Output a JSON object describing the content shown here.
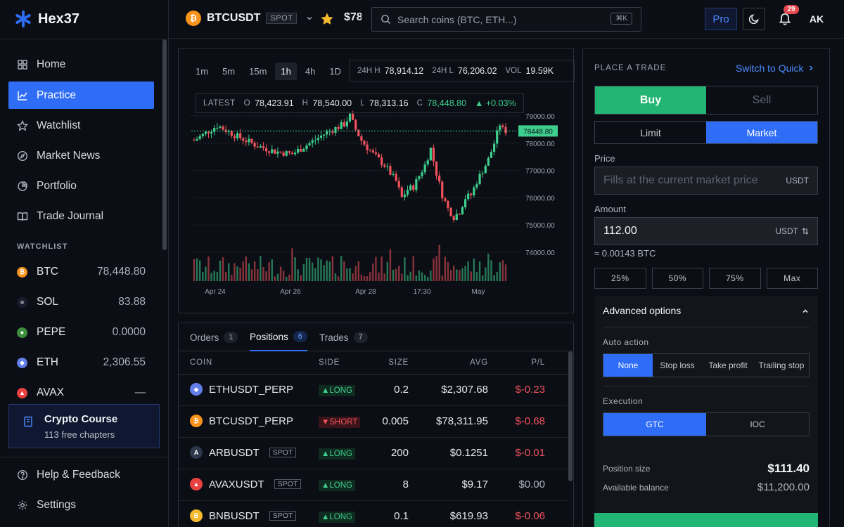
{
  "app": {
    "name": "Hex37"
  },
  "sidebar": {
    "nav": [
      {
        "label": "Home",
        "icon": "home-icon"
      },
      {
        "label": "Practice",
        "icon": "chart-line-icon",
        "active": true
      },
      {
        "label": "Watchlist",
        "icon": "star-icon"
      },
      {
        "label": "Market News",
        "icon": "compass-icon"
      },
      {
        "label": "Portfolio",
        "icon": "pie-icon"
      },
      {
        "label": "Trade Journal",
        "icon": "book-icon"
      }
    ],
    "watchlist_title": "WATCHLIST",
    "watchlist": [
      {
        "symbol": "BTC",
        "price": "78,448.80",
        "color": "#f7931a",
        "glyph": "₿"
      },
      {
        "symbol": "SOL",
        "price": "83.88",
        "color": "#1b1b2f",
        "glyph": "≡"
      },
      {
        "symbol": "PEPE",
        "price": "0.0000",
        "color": "#3f8f3f",
        "glyph": "●"
      },
      {
        "symbol": "ETH",
        "price": "2,306.55",
        "color": "#627eea",
        "glyph": "◆"
      },
      {
        "symbol": "AVAX",
        "price": "—",
        "color": "#e84142",
        "glyph": "▲"
      }
    ],
    "course": {
      "title": "Crypto Course",
      "subtitle": "113 free chapters"
    },
    "bottom": [
      {
        "label": "Help & Feedback",
        "icon": "help-icon"
      },
      {
        "label": "Settings",
        "icon": "gear-icon"
      }
    ]
  },
  "header": {
    "pair": "BTCUSDT",
    "market_type": "SPOT",
    "price_partial": "$78",
    "search_placeholder": "Search coins (BTC, ETH...)",
    "search_shortcut": "⌘K",
    "pro_label": "Pro",
    "notifications": "29",
    "avatar": "AK"
  },
  "chart": {
    "timeframes": [
      "1m",
      "5m",
      "15m",
      "1h",
      "4h",
      "1D"
    ],
    "active_timeframe": "1h",
    "stats": {
      "high_label": "24H H",
      "high": "78,914.12",
      "low_label": "24H L",
      "low": "76,206.02",
      "vol_label": "VOL",
      "vol": "19.59K"
    },
    "ohlc": {
      "label": "LATEST",
      "o_label": "O",
      "o": "78,423.91",
      "h_label": "H",
      "h": "78,540.00",
      "l_label": "L",
      "l": "78,313.16",
      "c_label": "C",
      "c": "78,448.80",
      "change": "▲ +0.03%"
    },
    "colors": {
      "up": "#3ecf8e",
      "down": "#f0525c"
    }
  },
  "chart_data": {
    "type": "candlestick",
    "x_tick_labels": [
      "Apr 24",
      "Apr 26",
      "Apr 28",
      "17:30",
      "May"
    ],
    "y_tick_labels": [
      "79000.00",
      "78000.00",
      "77000.00",
      "76000.00",
      "75000.00",
      "74000.00"
    ],
    "ylim": [
      74000,
      79000
    ],
    "last_price": 78448.8,
    "last_price_label": "78448.80",
    "close_path": [
      [
        0,
        78100
      ],
      [
        8,
        78650
      ],
      [
        14,
        78300
      ],
      [
        22,
        77900
      ],
      [
        28,
        77700
      ],
      [
        34,
        77600
      ],
      [
        40,
        78000
      ],
      [
        46,
        78400
      ],
      [
        52,
        78700
      ],
      [
        54,
        79000
      ],
      [
        56,
        78500
      ],
      [
        58,
        78100
      ],
      [
        62,
        77600
      ],
      [
        66,
        77200
      ],
      [
        70,
        76600
      ],
      [
        72,
        76000
      ],
      [
        74,
        76300
      ],
      [
        76,
        76400
      ],
      [
        80,
        77200
      ],
      [
        82,
        77800
      ],
      [
        84,
        76900
      ],
      [
        86,
        76100
      ],
      [
        88,
        75600
      ],
      [
        90,
        75300
      ],
      [
        92,
        75500
      ],
      [
        94,
        76000
      ],
      [
        96,
        76100
      ],
      [
        98,
        76600
      ],
      [
        100,
        77000
      ],
      [
        102,
        77400
      ],
      [
        104,
        78000
      ],
      [
        106,
        78700
      ],
      [
        107,
        78500
      ],
      [
        108,
        78450
      ]
    ]
  },
  "positions": {
    "tabs": [
      {
        "label": "Orders",
        "count": "1"
      },
      {
        "label": "Positions",
        "count": "6",
        "active": true
      },
      {
        "label": "Trades",
        "count": "7"
      }
    ],
    "columns": [
      "COIN",
      "SIDE",
      "SIZE",
      "AVG",
      "P/L"
    ],
    "rows": [
      {
        "coin": "ETHUSDT_PERP",
        "tag": "",
        "side": "▲LONG",
        "dir": "long",
        "size": "0.2",
        "avg": "$2,307.68",
        "pl": "$-0.23",
        "pl_type": "neg",
        "color": "#627eea",
        "glyph": "◆"
      },
      {
        "coin": "BTCUSDT_PERP",
        "tag": "",
        "side": "▼SHORT",
        "dir": "short",
        "size": "0.005",
        "avg": "$78,311.95",
        "pl": "$-0.68",
        "pl_type": "neg",
        "color": "#f7931a",
        "glyph": "₿"
      },
      {
        "coin": "ARBUSDT",
        "tag": "SPOT",
        "side": "▲LONG",
        "dir": "long",
        "size": "200",
        "avg": "$0.1251",
        "pl": "$-0.01",
        "pl_type": "neg",
        "color": "#2d374b",
        "glyph": "A"
      },
      {
        "coin": "AVAXUSDT",
        "tag": "SPOT",
        "side": "▲LONG",
        "dir": "long",
        "size": "8",
        "avg": "$9.17",
        "pl": "$0.00",
        "pl_type": "zero",
        "color": "#e84142",
        "glyph": "▲"
      },
      {
        "coin": "BNBUSDT",
        "tag": "SPOT",
        "side": "▲LONG",
        "dir": "long",
        "size": "0.1",
        "avg": "$619.93",
        "pl": "$-0.06",
        "pl_type": "neg",
        "color": "#f3ba2f",
        "glyph": "B"
      }
    ]
  },
  "trade": {
    "title": "PLACE A TRADE",
    "switch_label": "Switch to Quick",
    "buy": "Buy",
    "sell": "Sell",
    "limit": "Limit",
    "market": "Market",
    "price_label": "Price",
    "price_placeholder": "Fills at the current market price",
    "price_unit": "USDT",
    "amount_label": "Amount",
    "amount_value": "112.00",
    "amount_unit": "USDT",
    "approx": "≈ 0.00143 BTC",
    "percents": [
      "25%",
      "50%",
      "75%",
      "Max"
    ],
    "advanced": {
      "title": "Advanced options",
      "auto_label": "Auto action",
      "auto_options": [
        "None",
        "Stop loss",
        "Take profit",
        "Trailing stop"
      ],
      "exec_label": "Execution",
      "exec_options": [
        "GTC",
        "IOC"
      ],
      "pos_size_label": "Position size",
      "pos_size": "$111.40",
      "balance_label": "Available balance",
      "balance": "$11,200.00"
    }
  }
}
